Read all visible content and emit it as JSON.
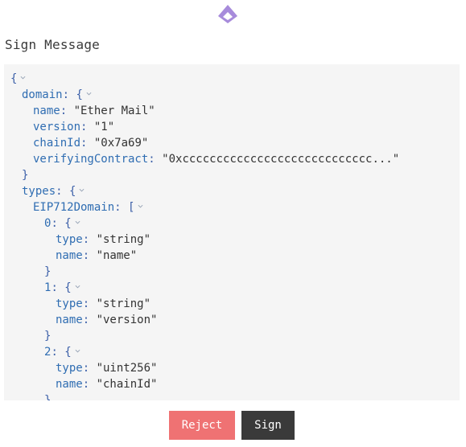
{
  "header": {
    "title": "Sign Message",
    "logo_color": "#a78bdb"
  },
  "message": {
    "lines": [
      {
        "indent": 0,
        "key": "",
        "text": "{",
        "chevron": true
      },
      {
        "indent": 1,
        "key": "domain",
        "text": "{",
        "chevron": true
      },
      {
        "indent": 2,
        "key": "name",
        "text": "\"Ether Mail\"",
        "chevron": false
      },
      {
        "indent": 2,
        "key": "version",
        "text": "\"1\"",
        "chevron": false
      },
      {
        "indent": 2,
        "key": "chainId",
        "text": "\"0x7a69\"",
        "chevron": false
      },
      {
        "indent": 2,
        "key": "verifyingContract",
        "text": "\"0xcccccccccccccccccccccccccccc...\"",
        "chevron": false
      },
      {
        "indent": 1,
        "key": "",
        "text": "}",
        "chevron": false
      },
      {
        "indent": 1,
        "key": "types",
        "text": "{",
        "chevron": true
      },
      {
        "indent": 2,
        "key": "EIP712Domain",
        "text": "[",
        "chevron": true
      },
      {
        "indent": 3,
        "key": "0",
        "text": "{",
        "chevron": true
      },
      {
        "indent": 4,
        "key": "type",
        "text": "\"string\"",
        "chevron": false
      },
      {
        "indent": 4,
        "key": "name",
        "text": "\"name\"",
        "chevron": false
      },
      {
        "indent": 3,
        "key": "",
        "text": "}",
        "chevron": false
      },
      {
        "indent": 3,
        "key": "1",
        "text": "{",
        "chevron": true
      },
      {
        "indent": 4,
        "key": "type",
        "text": "\"string\"",
        "chevron": false
      },
      {
        "indent": 4,
        "key": "name",
        "text": "\"version\"",
        "chevron": false
      },
      {
        "indent": 3,
        "key": "",
        "text": "}",
        "chevron": false
      },
      {
        "indent": 3,
        "key": "2",
        "text": "{",
        "chevron": true
      },
      {
        "indent": 4,
        "key": "type",
        "text": "\"uint256\"",
        "chevron": false
      },
      {
        "indent": 4,
        "key": "name",
        "text": "\"chainId\"",
        "chevron": false
      },
      {
        "indent": 3,
        "key": "",
        "text": "}",
        "chevron": false
      }
    ]
  },
  "actions": {
    "reject_label": "Reject",
    "sign_label": "Sign",
    "reject_color": "#ef7273",
    "sign_color": "#3a3a3a"
  }
}
